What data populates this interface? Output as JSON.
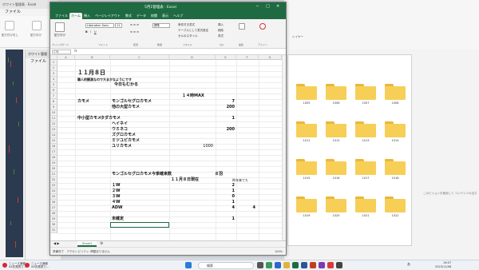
{
  "bg_left": {
    "title": "ホワイト管理表 · Excel",
    "menu": "ファイル",
    "tools": [
      "貼り付けをし",
      "貼り付け"
    ]
  },
  "bg_mid": {
    "title": "ホワイト管理",
    "menu": "ファイル"
  },
  "bg_right": {
    "layer_label": "レイヤー",
    "layer_label_2": "レイヤー",
    "side_hint": "このビジョンを使用して コンテンツの出力"
  },
  "excel": {
    "filename": "5月1管理表 · Excel",
    "window_controls": [
      "─",
      "□",
      "✕"
    ],
    "tabs": [
      "ファイル",
      "ホーム",
      "挿入",
      "ページレイアウト",
      "数式",
      "データ",
      "校閲",
      "表示",
      "ヘルプ"
    ],
    "active_tab": "ホーム",
    "ribbon": {
      "paste": "貼り付け",
      "clipboard": "クリップボード",
      "font_name": "Liberation Sans",
      "font_size": "11",
      "font_group": "フォント",
      "align_group": "配置",
      "number_format": "標準",
      "number_group": "数値",
      "styles": [
        "条件付き書式",
        "テーブルとして書式設定",
        "セルのスタイル"
      ],
      "styles_group": "スタイル",
      "cells": [
        "挿入",
        "削除",
        "書式"
      ],
      "cells_group": "セル",
      "edit_group": "編集",
      "addin": "アドイン",
      "fx": "fx"
    },
    "name_box": "C31",
    "columns": [
      "A",
      "B",
      "C",
      "D",
      "E",
      "F",
      "G"
    ],
    "rows": [
      "1",
      "2",
      "3",
      "4",
      "5",
      "6",
      "7",
      "8",
      "9",
      "10",
      "11",
      "12",
      "13",
      "14",
      "15",
      "16",
      "17",
      "18",
      "19",
      "20",
      "21",
      "22",
      "23",
      "24",
      "25",
      "26",
      "27",
      "28",
      "29",
      "30",
      "31"
    ],
    "cells": {
      "b2": "１１月８日",
      "b3": "職人的観測なので大まかなようにです",
      "c4": "今日もむかる",
      "d6": "１４時MAX",
      "b7": "カモメ",
      "c7": "モンゴルセグロカモメ",
      "e7": "7",
      "c8": "他の大型カモメ",
      "e8": "200",
      "b10": "中小型カモメ",
      "c10": "ウミネコ",
      "e10": "1",
      "c10b": "タダカモメ",
      "c11": "ヘイネイ",
      "c12": "ウミネコ",
      "e12": "200",
      "c13": "ズグロカモメ",
      "c14": "ミツユビカモメ",
      "c15": "ユリカモメ",
      "e15": "1000",
      "c20": "モンゴルセグロカモメ今季確来数",
      "e20": "８羽",
      "d21": "１１月８日現在",
      "f21": "昨年来てた",
      "c22": "１W",
      "e22": "2",
      "c23": "２W",
      "e23": "1",
      "c24": "３W",
      "e24": "0",
      "c25": "４W",
      "e25": "1",
      "c26": "ADW",
      "e26": "4",
      "f26": "4",
      "c28": "未確定",
      "e28": "1"
    },
    "sheet_tab": "Sheet1",
    "status": "準備完了　アクセシビリティ: 問題ありません",
    "zoom": "100%"
  },
  "explorer": {
    "folders": [
      "1005",
      "1006",
      "1007",
      "1008",
      "1011",
      "1012",
      "1013",
      "1014",
      "1015",
      "1016",
      "1017",
      "1018",
      "1019",
      "1020",
      "1021",
      "1022"
    ]
  },
  "taskbar": {
    "notif1": "ニュース速報\nXX氏発表で…",
    "notif2": "ニュース速報\nXX氏発表で…",
    "search_placeholder": "検索",
    "clock_time": "16:07",
    "clock_date": "2023/11/08",
    "lang": "あ"
  }
}
